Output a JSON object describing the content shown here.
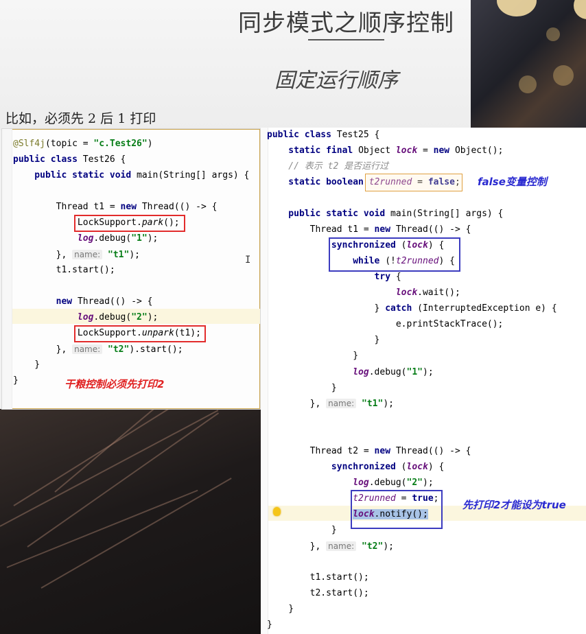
{
  "slide": {
    "title": "同步模式之顺序控制",
    "subtitle": "固定运行顺序",
    "example": "比如，必须先 2 后 1 打印"
  },
  "left_panel": {
    "lines": [
      [
        "@Slf4j",
        "(topic = ",
        "\"c.Test26\"",
        ")"
      ],
      [
        "public class ",
        "Test26 {"
      ],
      [
        "    public static void ",
        "main(String[] args) {"
      ],
      [
        "        Thread t1 = ",
        "new ",
        "Thread(() -> {"
      ],
      [
        "            LockSupport.",
        "park",
        "();"
      ],
      [
        "            ",
        "log",
        ".debug(",
        "\"1\"",
        ");"
      ],
      [
        "        }, ",
        "name:",
        " ",
        "\"t1\"",
        ");"
      ],
      [
        "        t1.start();"
      ],
      [
        "        ",
        "new ",
        "Thread(() -> {"
      ],
      [
        "            ",
        "log",
        ".debug(",
        "\"2\"",
        ");"
      ],
      [
        "            LockSupport.",
        "unpark",
        "(t1);"
      ],
      [
        "        }, ",
        "name:",
        " ",
        "\"t2\"",
        ").start();"
      ],
      [
        "    }"
      ],
      [
        "}"
      ]
    ],
    "note": "干粮控制必须先打印2"
  },
  "right_panel": {
    "lines": [
      [
        "public class ",
        "Test25 {"
      ],
      [
        "    static final ",
        "Object ",
        "lock",
        " = ",
        "new ",
        "Object();"
      ],
      [
        "    // 表示 t2 是否运行过"
      ],
      [
        "    static boolean ",
        "t2runned",
        " = ",
        "false",
        ";"
      ],
      [
        "    public static void ",
        "main(String[] args) {"
      ],
      [
        "        Thread t1 = ",
        "new ",
        "Thread(() -> {"
      ],
      [
        "            ",
        "synchronized ",
        "(",
        "lock",
        ") {"
      ],
      [
        "                ",
        "while ",
        "(!",
        "t2runned",
        ") {"
      ],
      [
        "                    ",
        "try ",
        "{"
      ],
      [
        "                        ",
        "lock",
        ".wait();"
      ],
      [
        "                    } ",
        "catch ",
        "(InterruptedException e) {"
      ],
      [
        "                        e.printStackTrace();"
      ],
      [
        "                    }"
      ],
      [
        "                }"
      ],
      [
        "                ",
        "log",
        ".debug(",
        "\"1\"",
        ");"
      ],
      [
        "            }"
      ],
      [
        "        }, ",
        "name:",
        " ",
        "\"t1\"",
        ");"
      ],
      [
        "        Thread t2 = ",
        "new ",
        "Thread(() -> {"
      ],
      [
        "            ",
        "synchronized ",
        "(",
        "lock",
        ") {"
      ],
      [
        "                ",
        "log",
        ".debug(",
        "\"2\"",
        ");"
      ],
      [
        "                ",
        "t2runned",
        " = ",
        "true",
        ";"
      ],
      [
        "                ",
        "lock",
        ".notify();"
      ],
      [
        "            }"
      ],
      [
        "        }, ",
        "name:",
        " ",
        "\"t2\"",
        ");"
      ],
      [
        "        t1.start();"
      ],
      [
        "        t2.start();"
      ],
      [
        "    }"
      ],
      [
        "}"
      ]
    ],
    "note_false": "false变量控制",
    "note_true": "先打印2才能设为true"
  },
  "colors": {
    "keyword": "#000080",
    "string": "#067d17",
    "field": "#660e7a",
    "comment": "#8c8c8c",
    "red_box": "#e22b2b",
    "blue_box": "#3b3bbf"
  },
  "icons": [
    "lightbulb-icon",
    "text-cursor-icon"
  ]
}
